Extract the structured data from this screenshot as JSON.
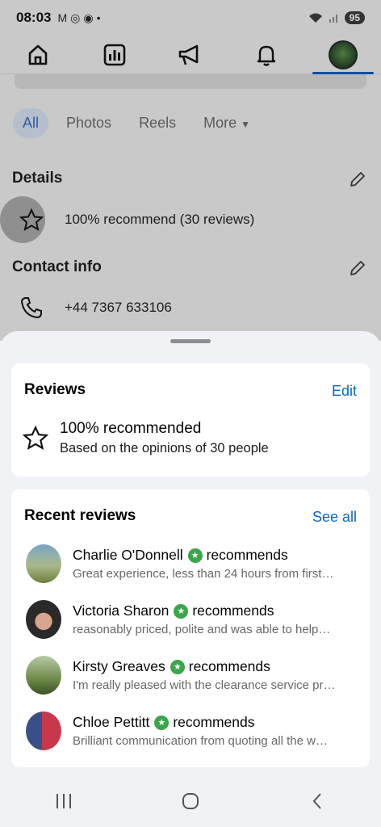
{
  "status": {
    "time": "08:03",
    "battery": "95"
  },
  "page": {
    "filters": [
      "All",
      "Photos",
      "Reels",
      "More"
    ],
    "details_title": "Details",
    "recommend_text": "100% recommend (30 reviews)",
    "contact_title": "Contact info",
    "phone": "+44 7367 633106"
  },
  "reviews_card": {
    "title": "Reviews",
    "edit_label": "Edit",
    "recommended_title": "100% recommended",
    "recommended_sub": "Based on the opinions of 30 people"
  },
  "recent_card": {
    "title": "Recent reviews",
    "see_all_label": "See all",
    "reviews": [
      {
        "name": "Charlie O'Donnell",
        "verb": "recommends",
        "quote": "Great experience, less than 24 hours from first…"
      },
      {
        "name": "Victoria Sharon",
        "verb": "recommends",
        "quote": "reasonably priced, polite and was able to help…"
      },
      {
        "name": "Kirsty Greaves",
        "verb": "recommends",
        "quote": "I'm really pleased with the clearance service pr…"
      },
      {
        "name": "Chloe Pettitt",
        "verb": "recommends",
        "quote": "Brilliant communication from quoting all the w…"
      }
    ]
  },
  "colors": {
    "accent": "#0a66c2",
    "badge": "#3aa64a",
    "dim": "#c9c9c9"
  }
}
